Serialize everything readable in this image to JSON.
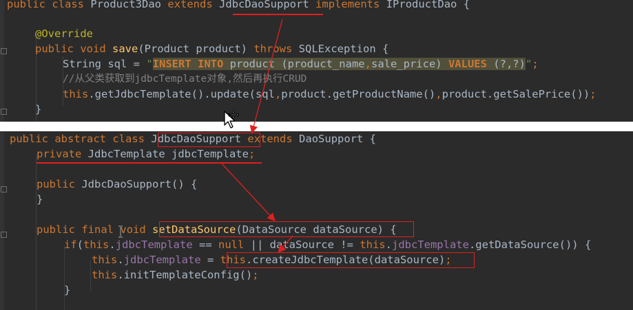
{
  "top_editor": {
    "line1": {
      "kw_public": "public",
      "kw_class": "class",
      "class_name": "Product3Dao",
      "kw_extends": "extends",
      "super_name": "JdbcDaoSupport",
      "kw_implements": "implements",
      "iface": "IProductDao",
      "brace": "{"
    },
    "line3": {
      "annotation": "@Override"
    },
    "line4": {
      "kw_public": "public",
      "kw_void": "void",
      "method": "save",
      "params": "(Product product) ",
      "kw_throws": "throws",
      "exception": "SQLException {"
    },
    "line5": {
      "decl": "String sql = ",
      "quote_open": "\"",
      "sql_insert": "INSERT INTO",
      "sql_mid": " product (product_name",
      "sql_comma": ",",
      "sql_rest": "sale_price) ",
      "sql_values": "VALUES",
      "sql_tail": " (?,?)",
      "quote_close": "\"",
      "semi": ";"
    },
    "line6": {
      "comment": "//从父类获取到jdbcTemplate对象,然后再执行CRUD"
    },
    "line7": {
      "kw_this": "this",
      "call": ".getJdbcTemplate().update(sql",
      "comma1": ",",
      "arg1": "product.getProductName()",
      "comma2": ",",
      "arg2": "product.getSalePrice())",
      "semi": ";"
    },
    "line8": {
      "brace": "}"
    }
  },
  "bottom_editor": {
    "line1": {
      "kw_public": "public",
      "kw_abstract": "abstract",
      "kw_class": "class",
      "class_name": "JdbcDaoSupport",
      "kw_extends": "extends",
      "super_name": "DaoSupport {"
    },
    "line2": {
      "kw_private": "private",
      "decl": "JdbcTemplate jdbcTemplate",
      "semi": ";"
    },
    "line4": {
      "kw_public": "public",
      "ctor": "JdbcDaoSupport",
      "rest": "() {"
    },
    "line5": {
      "brace": "}"
    },
    "line7": {
      "kw_public": "public",
      "kw_final": "final",
      "kw_void": "void",
      "method": "setDataSource",
      "params": "(DataSource dataSource)",
      "brace": " {"
    },
    "line8": {
      "kw_if": "if",
      "open": "(",
      "kw_this1": "this",
      "dot1": ".",
      "field1": "jdbcTemplate",
      "cmp1": " == ",
      "kw_null": "null",
      "or": " || ",
      "ds": "dataSource != ",
      "kw_this2": "this",
      "dot2": ".",
      "field2": "jdbcTemplate",
      "rest": ".getDataSource()) {"
    },
    "line9": {
      "kw_this1": "this",
      "dot1": ".",
      "field": "jdbcTemplate",
      "assign": " = ",
      "kw_this2": "this",
      "call": ".createJdbcTemplate(dataSource)",
      "semi": ";"
    },
    "line10": {
      "kw_this": "this",
      "call": ".initTemplateConfig()",
      "semi": ";"
    },
    "line11": {
      "brace": "}"
    }
  },
  "colors": {
    "background": "#2b2b2b",
    "keyword": "#cc7832",
    "method": "#ffc66d",
    "string": "#6a8759",
    "annotation": "#bbb529",
    "comment": "#808080",
    "field": "#9876aa",
    "text": "#a9b7c6",
    "markup_red": "#e02020"
  },
  "icons": {
    "move_cursor": "move-cursor-icon",
    "text_cursor": "text-cursor-icon"
  }
}
